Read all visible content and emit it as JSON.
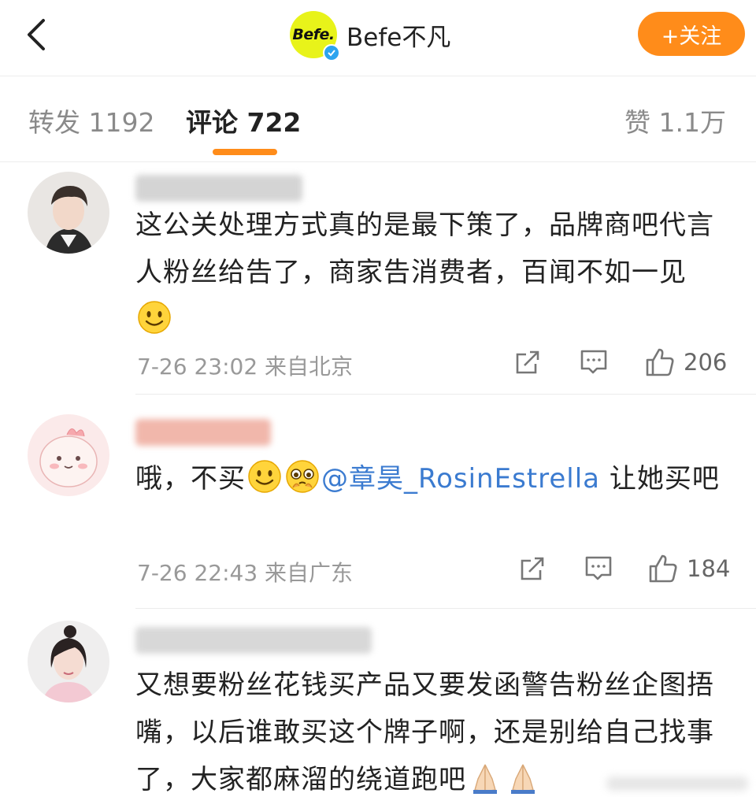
{
  "header": {
    "back_icon": "chevron-left-icon",
    "logo_text": "Befe.",
    "account_name": "Befe不凡",
    "follow_label": "+关注",
    "accent_color": "#ff8c1a",
    "logo_color": "#e8f31a",
    "verified_color": "#2ca4ef"
  },
  "tabs": {
    "repost": "转发 1192",
    "comments": "评论 722",
    "likes": "赞 1.1万"
  },
  "comments": [
    {
      "text": "这公关处理方式真的是最下策了，品牌商吧代言人粉丝给告了，商家告消费者，百闻不如一见",
      "emoji": [
        "smile-emoji"
      ],
      "time": "7-26 23:02",
      "location": "来自北京",
      "likes": "206"
    },
    {
      "text_before": "哦，不买",
      "emoji": [
        "smile-emoji",
        "pleading-emoji"
      ],
      "mention": "@章昊_RosinEstrella",
      "text_after": " 让她买吧",
      "time": "7-26 22:43",
      "location": "来自广东",
      "likes": "184"
    },
    {
      "text": "又想要粉丝花钱买产品又要发函警告粉丝企图捂嘴，以后谁敢买这个牌子啊，还是别给自己找事了，大家都麻溜的绕道跑吧",
      "emoji": [
        "folded-hands-emoji",
        "folded-hands-emoji"
      ]
    }
  ]
}
